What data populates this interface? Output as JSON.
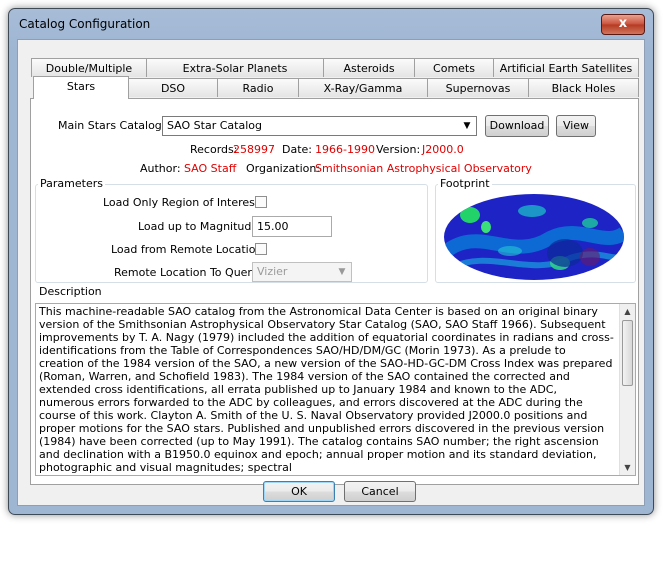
{
  "window": {
    "title": "Catalog Configuration",
    "close_glyph": "x"
  },
  "tabs": {
    "back_row": [
      "Double/Multiple Stars",
      "Extra-Solar Planets",
      "Asteroids",
      "Comets",
      "Artificial Earth Satellites"
    ],
    "front_row": [
      "Stars",
      "DSO",
      "Radio",
      "X-Ray/Gamma",
      "Supernovas",
      "Black Holes"
    ],
    "active": "Stars"
  },
  "catalog": {
    "label": "Main Stars Catalog:",
    "selected": "SAO Star Catalog",
    "download_label": "Download",
    "view_label": "View"
  },
  "info": {
    "records_label": "Records:",
    "records": "258997",
    "date_label": "Date:",
    "date": "1966-1990",
    "version_label": "Version:",
    "version": "J2000.0",
    "author_label": "Author:",
    "author": "SAO Staff",
    "organization_label": "Organization:",
    "organization": "Smithsonian Astrophysical Observatory"
  },
  "parameters": {
    "legend": "Parameters",
    "region_label": "Load Only Region of Interest:",
    "region_checked": false,
    "magnitude_label": "Load up to Magnitude:",
    "magnitude_value": "15.00",
    "remote_label": "Load from Remote Location:",
    "remote_checked": false,
    "remote_query_label": "Remote Location To Query:",
    "remote_query_value": "Vizier"
  },
  "footprint": {
    "legend": "Footprint"
  },
  "description": {
    "legend": "Description",
    "text": "This machine-readable SAO catalog from the Astronomical Data Center is based on an original binary version of the Smithsonian Astrophysical Observatory Star Catalog (SAO, SAO Staff 1966). Subsequent improvements by T. A. Nagy (1979) included the addition of equatorial coordinates in radians and cross-identifications from the Table of Correspondences SAO/HD/DM/GC (Morin 1973). As a prelude to creation of the 1984 version of the SAO, a new version of the SAO-HD-GC-DM Cross Index was prepared (Roman, Warren, and Schofield 1983). The 1984 version of the SAO contained the corrected and extended cross identifications, all errata published up to January 1984 and known to the ADC, numerous errors forwarded to the ADC by colleagues, and errors discovered at the ADC during the course of this work. Clayton A. Smith of the U. S. Naval Observatory provided J2000.0 positions and proper motions for the SAO stars. Published and unpublished errors discovered in the previous version (1984) have been corrected (up to May 1991). The catalog contains SAO number; the right ascension and declination with a B1950.0 equinox and epoch; annual proper motion and its standard deviation, photographic and visual magnitudes; spectral"
  },
  "footer": {
    "ok_label": "OK",
    "cancel_label": "Cancel"
  },
  "colors": {
    "value_red": "#e00000",
    "title_bar": "#9fb6d3",
    "footprint_bg": "#1820c8"
  }
}
